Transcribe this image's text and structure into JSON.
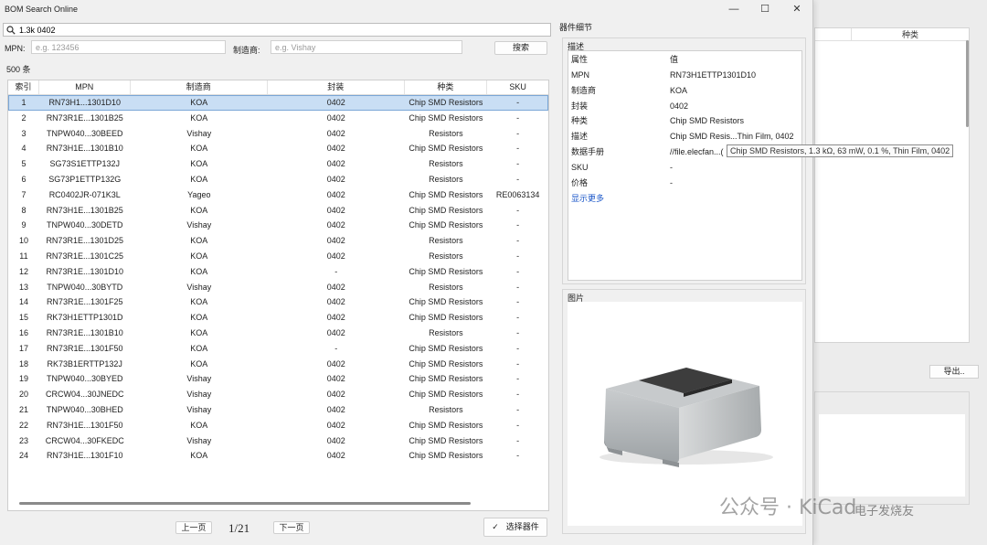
{
  "app": {
    "title": "BOM Search Online"
  },
  "window_controls": {
    "minimize": "—",
    "maximize": "☐",
    "close": "✕"
  },
  "search": {
    "value": "1.3k 0402",
    "icon": "search-icon"
  },
  "filters": {
    "mpn_label": "MPN:",
    "mpn_placeholder": "e.g. 123456",
    "manufacturer_label": "制造商:",
    "manufacturer_placeholder": "e.g. Vishay",
    "search_button": "搜索"
  },
  "result_count": "500 条",
  "table": {
    "columns": [
      "索引",
      "MPN",
      "制造商",
      "封装",
      "种类",
      "SKU"
    ],
    "rows": [
      [
        "1",
        "RN73H1...1301D10",
        "KOA",
        "0402",
        "Chip SMD Resistors",
        "-"
      ],
      [
        "2",
        "RN73R1E...1301B25",
        "KOA",
        "0402",
        "Chip SMD Resistors",
        "-"
      ],
      [
        "3",
        "TNPW040...30BEED",
        "Vishay",
        "0402",
        "Resistors",
        "-"
      ],
      [
        "4",
        "RN73H1E...1301B10",
        "KOA",
        "0402",
        "Chip SMD Resistors",
        "-"
      ],
      [
        "5",
        "SG73S1ETTP132J",
        "KOA",
        "0402",
        "Resistors",
        "-"
      ],
      [
        "6",
        "SG73P1ETTP132G",
        "KOA",
        "0402",
        "Resistors",
        "-"
      ],
      [
        "7",
        "RC0402JR-071K3L",
        "Yageo",
        "0402",
        "Chip SMD Resistors",
        "RE0063134"
      ],
      [
        "8",
        "RN73H1E...1301B25",
        "KOA",
        "0402",
        "Chip SMD Resistors",
        "-"
      ],
      [
        "9",
        "TNPW040...30DETD",
        "Vishay",
        "0402",
        "Chip SMD Resistors",
        "-"
      ],
      [
        "10",
        "RN73R1E...1301D25",
        "KOA",
        "0402",
        "Resistors",
        "-"
      ],
      [
        "11",
        "RN73R1E...1301C25",
        "KOA",
        "0402",
        "Resistors",
        "-"
      ],
      [
        "12",
        "RN73R1E...1301D10",
        "KOA",
        "-",
        "Chip SMD Resistors",
        "-"
      ],
      [
        "13",
        "TNPW040...30BYTD",
        "Vishay",
        "0402",
        "Resistors",
        "-"
      ],
      [
        "14",
        "RN73R1E...1301F25",
        "KOA",
        "0402",
        "Chip SMD Resistors",
        "-"
      ],
      [
        "15",
        "RK73H1ETTP1301D",
        "KOA",
        "0402",
        "Chip SMD Resistors",
        "-"
      ],
      [
        "16",
        "RN73R1E...1301B10",
        "KOA",
        "0402",
        "Resistors",
        "-"
      ],
      [
        "17",
        "RN73R1E...1301F50",
        "KOA",
        "-",
        "Chip SMD Resistors",
        "-"
      ],
      [
        "18",
        "RK73B1ERTTP132J",
        "KOA",
        "0402",
        "Chip SMD Resistors",
        "-"
      ],
      [
        "19",
        "TNPW040...30BYED",
        "Vishay",
        "0402",
        "Chip SMD Resistors",
        "-"
      ],
      [
        "20",
        "CRCW04...30JNEDC",
        "Vishay",
        "0402",
        "Chip SMD Resistors",
        "-"
      ],
      [
        "21",
        "TNPW040...30BHED",
        "Vishay",
        "0402",
        "Resistors",
        "-"
      ],
      [
        "22",
        "RN73H1E...1301F50",
        "KOA",
        "0402",
        "Chip SMD Resistors",
        "-"
      ],
      [
        "23",
        "CRCW04...30FKEDC",
        "Vishay",
        "0402",
        "Chip SMD Resistors",
        "-"
      ],
      [
        "24",
        "RN73H1E...1301F10",
        "KOA",
        "0402",
        "Chip SMD Resistors",
        "-"
      ]
    ],
    "selected_row": 0
  },
  "pager": {
    "prev": "上一页",
    "page": "1/21",
    "next": "下一页"
  },
  "choose_button": {
    "check": "✓",
    "label": "选择器件"
  },
  "detail": {
    "title": "器件细节",
    "desc_group": "描述",
    "header_key": "属性",
    "header_value": "值",
    "props": [
      {
        "k": "MPN",
        "v": "RN73H1ETTP1301D10"
      },
      {
        "k": "制造商",
        "v": "KOA"
      },
      {
        "k": "封装",
        "v": "0402"
      },
      {
        "k": "种类",
        "v": "Chip SMD Resistors"
      },
      {
        "k": "描述",
        "v": "Chip SMD Resis...Thin Film, 0402"
      },
      {
        "k": "数据手册",
        "v": "//file.elecfan...("
      },
      {
        "k": "SKU",
        "v": "-"
      },
      {
        "k": "价格",
        "v": "-"
      }
    ],
    "more_link": "显示更多",
    "tooltip": "Chip SMD Resistors, 1.3 kΩ, 63 mW, 0.1 %, Thin Film, 0402",
    "image_group": "图片"
  },
  "background_window": {
    "column_header": "种类",
    "export_button": "导出.."
  },
  "watermark": {
    "text": "公众号 · KiCad",
    "logo": "电子发烧友"
  }
}
